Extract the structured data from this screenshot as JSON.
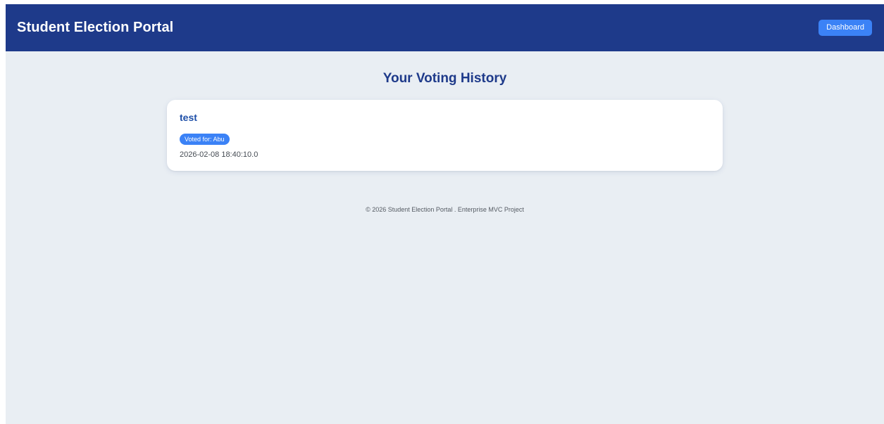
{
  "navbar": {
    "brand": "Student Election Portal",
    "dashboard_label": "Dashboard"
  },
  "main": {
    "title": "Your Voting History",
    "history": [
      {
        "election": "test",
        "badge": "Voted for: Abu",
        "timestamp": "2026-02-08 18:40:10.0"
      }
    ]
  },
  "footer": {
    "text": "© 2026 Student Election Portal . Enterprise MVC Project"
  },
  "colors": {
    "navbar_bg": "#1e3a8a",
    "accent": "#3b82f6",
    "page_bg": "#e9eef3"
  }
}
